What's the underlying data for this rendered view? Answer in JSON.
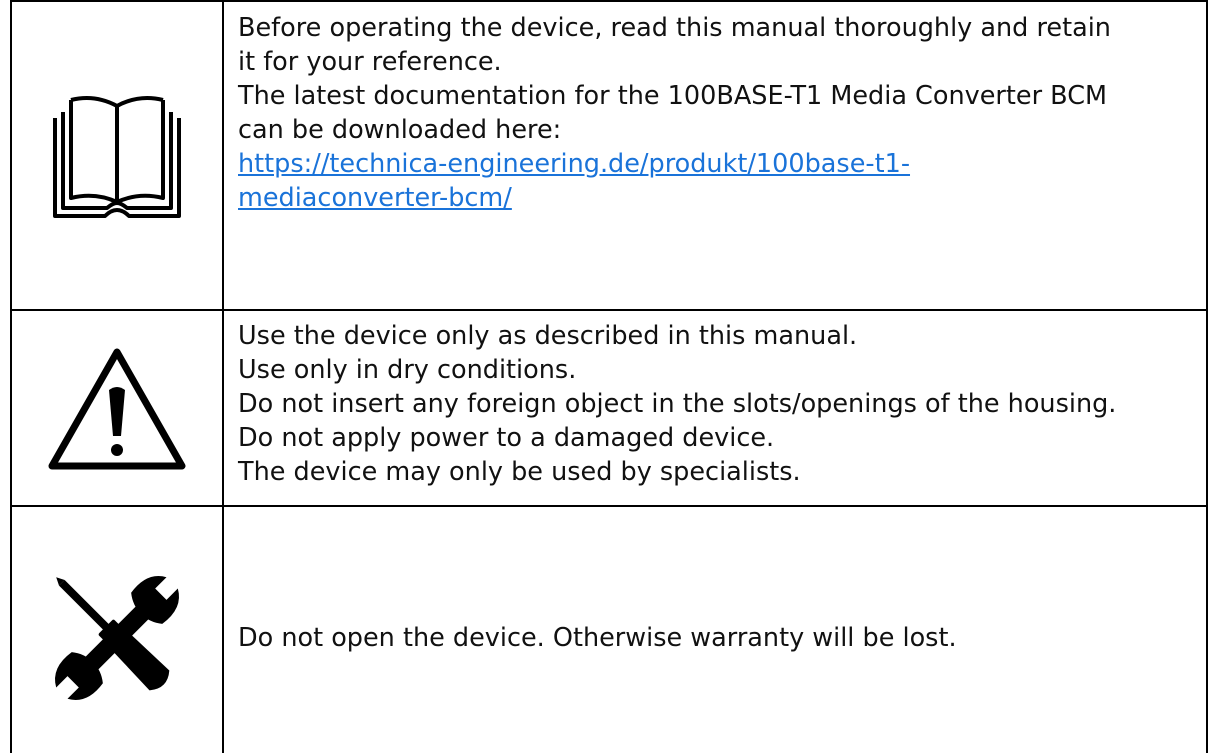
{
  "colors": {
    "text": "#111111",
    "link": "#1a73d9",
    "border": "#000000"
  },
  "rows": [
    {
      "icon": "book-icon",
      "lines": [
        "Before operating the device, read this manual thoroughly and retain",
        "it for your reference.",
        "The latest documentation for the 100BASE-T1 Media Converter BCM",
        "can be downloaded here:"
      ],
      "link_lines": [
        "https://technica-engineering.de/produkt/100base-t1-",
        "mediaconverter-bcm/"
      ]
    },
    {
      "icon": "warning-triangle-icon",
      "lines": [
        "Use the device only as described in this manual.",
        "Use only in dry conditions.",
        "Do not insert any foreign object in the slots/openings of the housing.",
        "Do not apply power to a damaged device.",
        "The device may only be used by specialists."
      ]
    },
    {
      "icon": "tools-icon",
      "lines": [
        "Do not open the device. Otherwise warranty will be lost."
      ]
    }
  ]
}
